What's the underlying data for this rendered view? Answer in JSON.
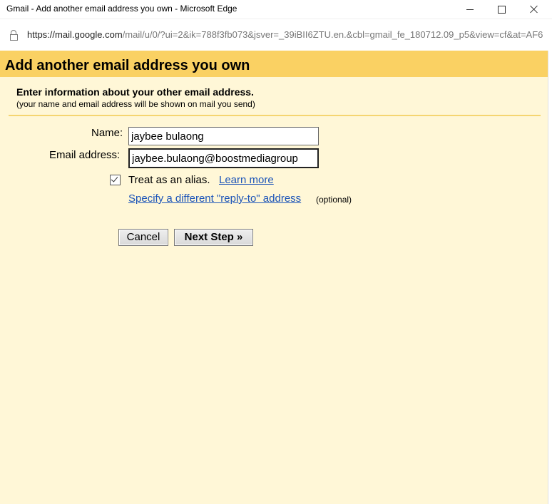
{
  "window": {
    "title": "Gmail - Add another email address you own - Microsoft Edge",
    "url_host": "https://mail.google.com",
    "url_path": "/mail/u/0/?ui=2&ik=788f3fb073&jsver=_39iBII6ZTU.en.&cbl=gmail_fe_180712.09_p5&view=cf&at=AF6"
  },
  "dialog": {
    "header": "Add another email address you own",
    "intro_title": "Enter information about your other email address.",
    "intro_sub": "(your name and email address will be shown on mail you send)",
    "name_label": "Name:",
    "name_value": "jaybee bulaong",
    "email_label": "Email address:",
    "email_value": "jaybee.bulaong@boostmediagroup",
    "alias_label": "Treat as an alias.",
    "alias_checked": true,
    "learn_more": "Learn more",
    "reply_to_link": "Specify a different \"reply-to\" address",
    "optional": "(optional)",
    "cancel_label": "Cancel",
    "next_label": "Next Step »"
  },
  "colors": {
    "header_band": "#fad163",
    "panel_bg": "#fff7d7",
    "link": "#1a53b8"
  }
}
